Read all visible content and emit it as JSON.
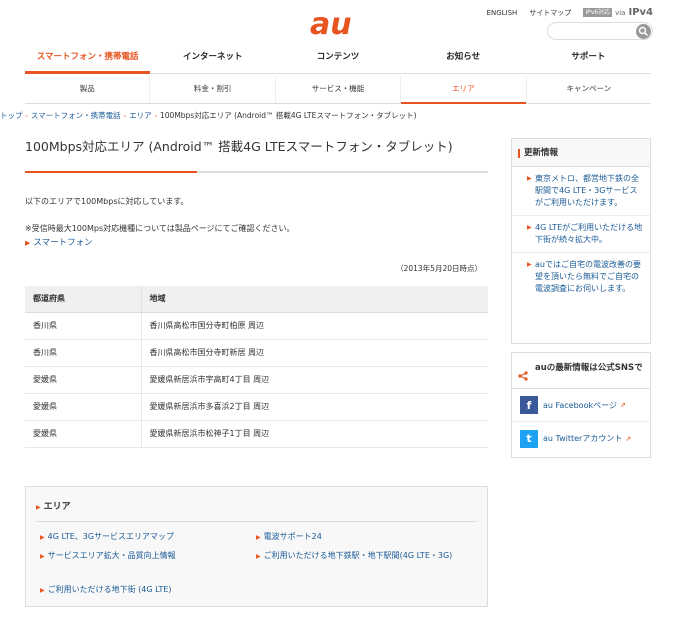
{
  "header": {
    "logo_text": "au",
    "utility_links": [
      "ENGLISH",
      "サイトマップ"
    ],
    "ipv6_badge": "IPv6対応",
    "ipv6_via": "via",
    "ipv6_protocol": "IPv4",
    "search_placeholder": ""
  },
  "global_nav": [
    {
      "label": "スマートフォン・携帯電話",
      "active": true
    },
    {
      "label": "インターネット",
      "active": false
    },
    {
      "label": "コンテンツ",
      "active": false
    },
    {
      "label": "お知らせ",
      "active": false
    },
    {
      "label": "サポート",
      "active": false
    }
  ],
  "sub_nav": [
    {
      "label": "製品",
      "active": false
    },
    {
      "label": "料金・割引",
      "active": false
    },
    {
      "label": "サービス・機能",
      "active": false
    },
    {
      "label": "エリア",
      "active": true
    },
    {
      "label": "キャンペーン",
      "active": false
    }
  ],
  "breadcrumb": [
    "トップ",
    "スマートフォン・携帯電話",
    "エリア",
    "100Mbps対応エリア (Android™ 搭載4G LTEスマートフォン・タブレット)"
  ],
  "main": {
    "title": "100Mbps対応エリア (Android™ 搭載4G LTEスマートフォン・タブレット)",
    "intro": "以下のエリアで100Mbpsに対応しています。",
    "note": "※受信時最大100Mps対応機種については製品ページにてご確認ください。",
    "smartphone_link": "スマートフォン",
    "date": "（2013年5月20日時点）",
    "table": {
      "headers": [
        "都道府県",
        "地域"
      ],
      "rows": [
        [
          "香川県",
          "香川県高松市国分寺町柏原 周辺"
        ],
        [
          "香川県",
          "香川県高松市国分寺町新居 周辺"
        ],
        [
          "愛媛県",
          "愛媛県新居浜市宇高町4丁目 周辺"
        ],
        [
          "愛媛県",
          "愛媛県新居浜市多喜浜2丁目 周辺"
        ],
        [
          "愛媛県",
          "愛媛県新居浜市松神子1丁目 周辺"
        ]
      ]
    }
  },
  "area_box": {
    "title": "エリア",
    "links": [
      "4G LTE、3Gサービスエリアマップ",
      "電波サポート24",
      "サービスエリア拡大・品質向上情報",
      "ご利用いただける地下鉄駅・地下駅間(4G LTE・3G)",
      "ご利用いただける地下街 (4G LTE)"
    ]
  },
  "sidebar": {
    "news_title": "更新情報",
    "news_items": [
      "東京メトロ、都営地下鉄の全駅間で4G LTE・3Gサービスがご利用いただけます。",
      "4G LTEがご利用いただける地下街が続々拡大中。",
      "auではご自宅の電波改善の要望を頂いたら無料でご自宅の電波調査にお伺いします。"
    ],
    "sns_title": "auの最新情報は公式SNSで",
    "sns_links": [
      {
        "label": "au Facebookページ",
        "icon": "facebook-icon"
      },
      {
        "label": "au Twitterアカウント",
        "icon": "twitter-icon"
      }
    ]
  },
  "colors": {
    "accent": "#e8541f",
    "link": "#1a5a96"
  }
}
